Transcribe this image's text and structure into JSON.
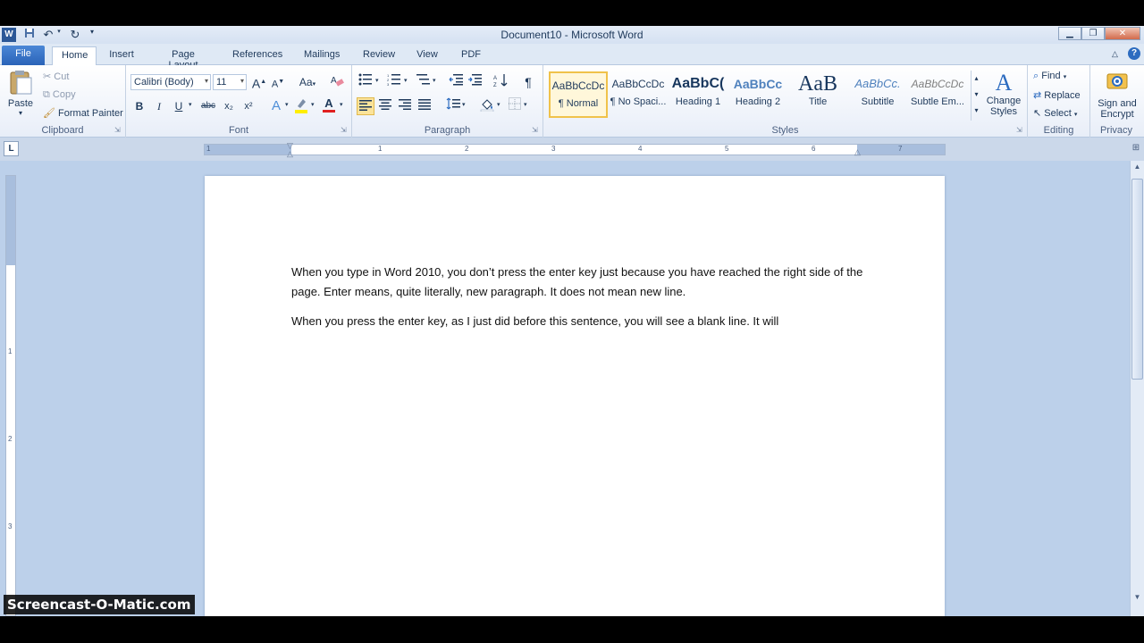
{
  "window": {
    "title": "Document10 - Microsoft Word"
  },
  "qat": {
    "word_icon": "word-icon",
    "save_icon": "save-icon",
    "undo_icon": "undo-icon",
    "redo_icon": "redo-icon",
    "customize_icon": "customize-icon"
  },
  "window_controls": {
    "minimize": "▁",
    "restore": "❐",
    "close": "✕"
  },
  "tabs": [
    {
      "label": "File"
    },
    {
      "label": "Home"
    },
    {
      "label": "Insert"
    },
    {
      "label": "Page Layout"
    },
    {
      "label": "References"
    },
    {
      "label": "Mailings"
    },
    {
      "label": "Review"
    },
    {
      "label": "View"
    },
    {
      "label": "PDF"
    }
  ],
  "ribbon": {
    "clipboard": {
      "label": "Clipboard",
      "paste": "Paste",
      "cut": "Cut",
      "copy": "Copy",
      "format_painter": "Format Painter"
    },
    "font": {
      "label": "Font",
      "font_name": "Calibri (Body)",
      "font_size": "11",
      "bold": "B",
      "italic": "I",
      "underline": "U",
      "strike": "abc",
      "subscript": "x₂",
      "superscript": "x²",
      "grow": "A",
      "shrink": "A",
      "change_case": "Aa",
      "font_color": "A"
    },
    "paragraph": {
      "label": "Paragraph",
      "pilcrow": "¶"
    },
    "styles": {
      "label": "Styles",
      "items": [
        {
          "sample": "AaBbCcDc",
          "name": "¶ Normal"
        },
        {
          "sample": "AaBbCcDc",
          "name": "¶ No Spaci..."
        },
        {
          "sample": "AaBbC(",
          "name": "Heading 1"
        },
        {
          "sample": "AaBbCc",
          "name": "Heading 2"
        },
        {
          "sample": "AaB",
          "name": "Title"
        },
        {
          "sample": "AaBbCc.",
          "name": "Subtitle"
        },
        {
          "sample": "AaBbCcDc",
          "name": "Subtle Em..."
        }
      ],
      "change_styles": "Change Styles"
    },
    "editing": {
      "label": "Editing",
      "find": "Find",
      "replace": "Replace",
      "select": "Select"
    },
    "privacy": {
      "label": "Privacy",
      "sign_encrypt": "Sign and Encrypt"
    }
  },
  "ruler": {
    "numbers": [
      "1",
      "1",
      "2",
      "3",
      "4",
      "5",
      "6",
      "7"
    ],
    "tab_selector": "L"
  },
  "document": {
    "paragraphs": [
      "When you type in Word 2010, you don’t press the enter key just because you have reached the right side of the page. Enter means, quite literally, new paragraph. It does not mean new line.",
      "When you press the enter key, as I just did before this sentence, you will see a blank line. It will"
    ]
  },
  "vruler": {
    "numbers": [
      "1",
      "2",
      "3"
    ]
  },
  "watermark": "Screencast-O-Matic.com"
}
